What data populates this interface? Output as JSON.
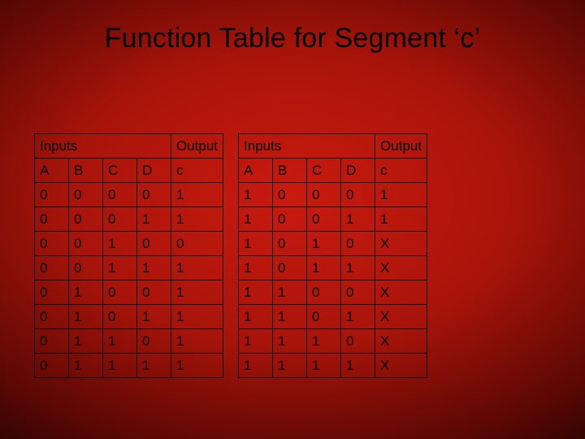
{
  "title": "Function Table for Segment ‘c’",
  "left": {
    "inputs_label": "Inputs",
    "output_label": "Output",
    "cols": [
      "A",
      "B",
      "C",
      "D",
      "c"
    ],
    "rows": [
      [
        "0",
        "0",
        "0",
        "0",
        "1"
      ],
      [
        "0",
        "0",
        "0",
        "1",
        "1"
      ],
      [
        "0",
        "0",
        "1",
        "0",
        "0"
      ],
      [
        "0",
        "0",
        "1",
        "1",
        "1"
      ],
      [
        "0",
        "1",
        "0",
        "0",
        "1"
      ],
      [
        "0",
        "1",
        "0",
        "1",
        "1"
      ],
      [
        "0",
        "1",
        "1",
        "0",
        "1"
      ],
      [
        "0",
        "1",
        "1",
        "1",
        "1"
      ]
    ]
  },
  "right": {
    "inputs_label": "Inputs",
    "output_label": "Output",
    "cols": [
      "A",
      "B",
      "C",
      "D",
      "c"
    ],
    "rows": [
      [
        "1",
        "0",
        "0",
        "0",
        "1"
      ],
      [
        "1",
        "0",
        "0",
        "1",
        "1"
      ],
      [
        "1",
        "0",
        "1",
        "0",
        "X"
      ],
      [
        "1",
        "0",
        "1",
        "1",
        "X"
      ],
      [
        "1",
        "1",
        "0",
        "0",
        "X"
      ],
      [
        "1",
        "1",
        "0",
        "1",
        "X"
      ],
      [
        "1",
        "1",
        "1",
        "0",
        "X"
      ],
      [
        "1",
        "1",
        "1",
        "1",
        "X"
      ]
    ]
  }
}
